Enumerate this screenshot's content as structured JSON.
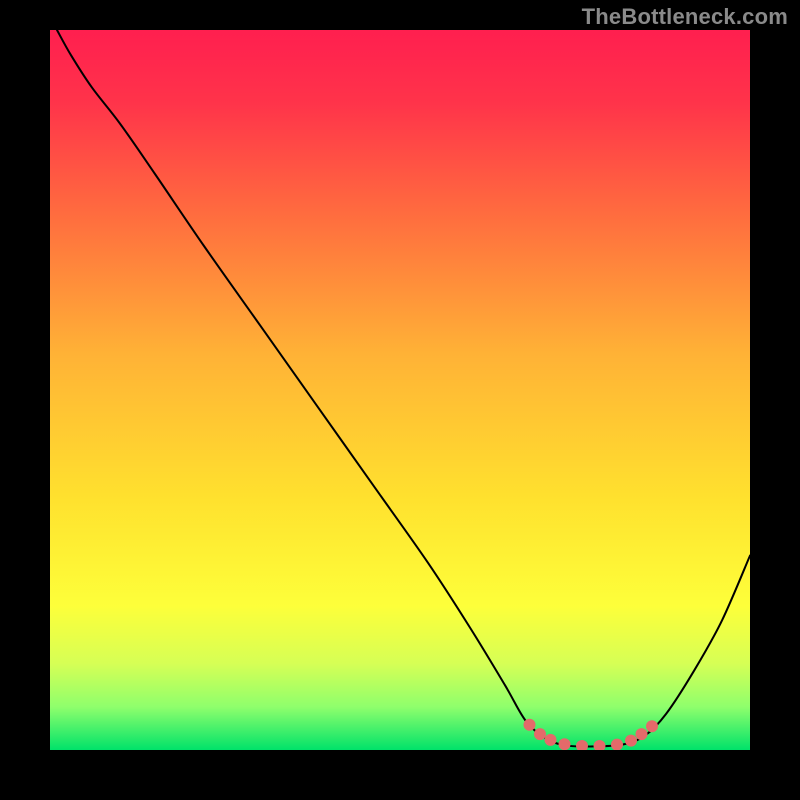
{
  "watermark": "TheBottleneck.com",
  "chart_data": {
    "type": "line",
    "title": "",
    "xlabel": "",
    "ylabel": "",
    "xlim": [
      0,
      100
    ],
    "ylim": [
      0,
      100
    ],
    "background": {
      "type": "vertical-gradient",
      "stops": [
        {
          "offset": 0.0,
          "color": "#ff1f4f"
        },
        {
          "offset": 0.1,
          "color": "#ff334a"
        },
        {
          "offset": 0.25,
          "color": "#ff6a3f"
        },
        {
          "offset": 0.45,
          "color": "#ffb236"
        },
        {
          "offset": 0.65,
          "color": "#ffe12e"
        },
        {
          "offset": 0.8,
          "color": "#fdff3a"
        },
        {
          "offset": 0.88,
          "color": "#d6ff55"
        },
        {
          "offset": 0.94,
          "color": "#8fff6c"
        },
        {
          "offset": 1.0,
          "color": "#00e26a"
        }
      ]
    },
    "series": [
      {
        "name": "bottleneck-curve",
        "color": "#000000",
        "width": 2,
        "points": [
          {
            "x": 1,
            "y": 100
          },
          {
            "x": 3,
            "y": 96.5
          },
          {
            "x": 6,
            "y": 92
          },
          {
            "x": 10,
            "y": 87
          },
          {
            "x": 15,
            "y": 80
          },
          {
            "x": 22,
            "y": 70
          },
          {
            "x": 30,
            "y": 59
          },
          {
            "x": 38,
            "y": 48
          },
          {
            "x": 46,
            "y": 37
          },
          {
            "x": 54,
            "y": 26
          },
          {
            "x": 60,
            "y": 17
          },
          {
            "x": 65,
            "y": 9
          },
          {
            "x": 68,
            "y": 4
          },
          {
            "x": 71,
            "y": 1.5
          },
          {
            "x": 74,
            "y": 0.6
          },
          {
            "x": 78,
            "y": 0.5
          },
          {
            "x": 82,
            "y": 0.8
          },
          {
            "x": 85,
            "y": 2
          },
          {
            "x": 88,
            "y": 5
          },
          {
            "x": 92,
            "y": 11
          },
          {
            "x": 96,
            "y": 18
          },
          {
            "x": 100,
            "y": 27
          }
        ]
      },
      {
        "name": "highlight-dots",
        "color": "#e46a6a",
        "radius": 6,
        "points": [
          {
            "x": 68.5,
            "y": 3.5
          },
          {
            "x": 70.0,
            "y": 2.2
          },
          {
            "x": 71.5,
            "y": 1.4
          },
          {
            "x": 73.5,
            "y": 0.8
          },
          {
            "x": 76.0,
            "y": 0.55
          },
          {
            "x": 78.5,
            "y": 0.55
          },
          {
            "x": 81.0,
            "y": 0.75
          },
          {
            "x": 83.0,
            "y": 1.3
          },
          {
            "x": 84.5,
            "y": 2.2
          },
          {
            "x": 86.0,
            "y": 3.3
          }
        ]
      }
    ]
  }
}
